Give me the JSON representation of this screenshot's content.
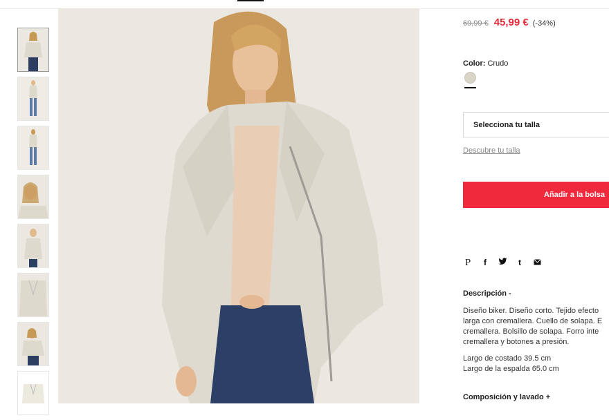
{
  "price": {
    "old": "69,99 €",
    "new": "45,99 €",
    "discount": "(-34%)"
  },
  "color": {
    "label": "Color:",
    "value": "Crudo",
    "swatch_hex": "#d9d6c8"
  },
  "size": {
    "select_label": "Selecciona tu talla",
    "guide_link": "Descubre tu talla"
  },
  "cart": {
    "add_label": "Añadir a la bolsa"
  },
  "share": {
    "pinterest": "P",
    "facebook": "f",
    "twitter": "y",
    "tumblr": "t"
  },
  "description": {
    "title": "Descripción -",
    "lines": [
      "Diseño biker. Diseño corto. Tejido efecto",
      "larga con cremallera. Cuello de solapa. E",
      "cremallera. Bolsillo de solapa. Forro inte",
      "cremallera y botones a presión."
    ],
    "measures": [
      "Largo de costado 39.5 cm",
      "Largo de la espalda 65.0 cm"
    ]
  },
  "composition": {
    "title": "Composición y lavado +"
  },
  "colors": {
    "accent": "#ee2a3c",
    "price_red": "#e52b3c"
  },
  "thumbnails": {
    "count": 8
  }
}
